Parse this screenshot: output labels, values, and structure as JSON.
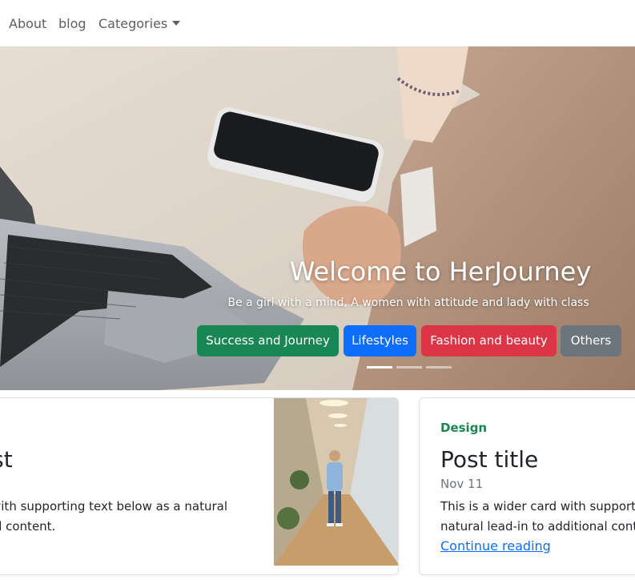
{
  "nav": {
    "about": "About",
    "blog": "blog",
    "categories": "Categories"
  },
  "hero": {
    "title": "Welcome to HerJourney",
    "subtitle": "Be a girl with a mind, A women with attitude and lady with class",
    "buttons": [
      {
        "label": "Success and Journey",
        "color": "#198754"
      },
      {
        "label": "Lifestyles",
        "color": "#0d6efd"
      },
      {
        "label": "Fashion and beauty",
        "color": "#dc3545"
      },
      {
        "label": "Others",
        "color": "#6c757d"
      }
    ],
    "active_slide": 1,
    "slide_count": 3
  },
  "cards": {
    "left": {
      "title": "ost",
      "text_lines": [
        "with supporting text below as a natural",
        "al content."
      ]
    },
    "right": {
      "category": "Design",
      "title": "Post title",
      "date": "Nov 11",
      "text_lines": [
        "This is a wider card with supporti",
        "natural lead-in to additional conte"
      ],
      "link": "Continue reading"
    }
  }
}
